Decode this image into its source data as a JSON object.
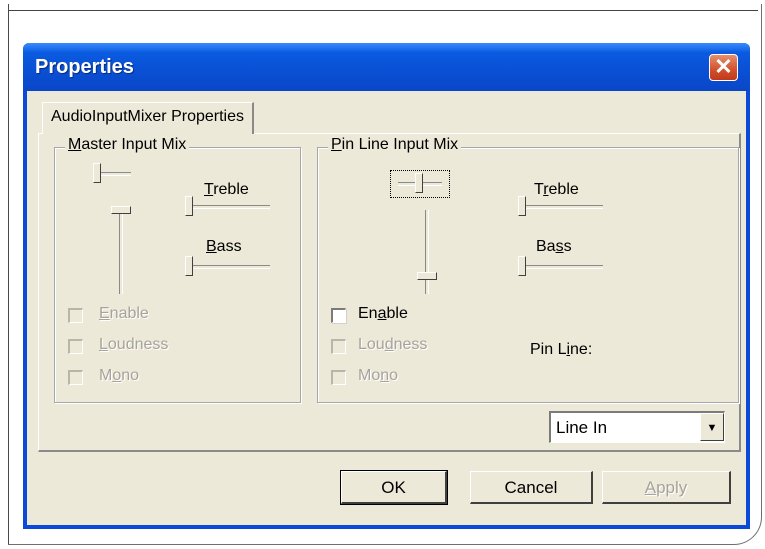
{
  "dialog": {
    "title": "Properties",
    "close_glyph": "✕"
  },
  "tab": {
    "label": "AudioInputMixer Properties"
  },
  "master": {
    "group_label": "Master Input Mix",
    "treble_label": "Treble",
    "bass_label": "Bass",
    "enable_label": "Enable",
    "loudness_label": "Loudness",
    "mono_label": "Mono",
    "enable_enabled": false,
    "loudness_enabled": false,
    "mono_enabled": false
  },
  "pinline": {
    "group_label": "Pin Line Input Mix",
    "treble_label": "Treble",
    "bass_label": "Bass",
    "enable_label": "Enable",
    "loudness_label": "Loudness",
    "mono_label": "Mono",
    "pin_line_label": "Pin Line:",
    "pin_line_value": "Line In",
    "dropdown_glyph": "▼"
  },
  "buttons": {
    "ok": "OK",
    "cancel": "Cancel",
    "apply": "Apply"
  }
}
